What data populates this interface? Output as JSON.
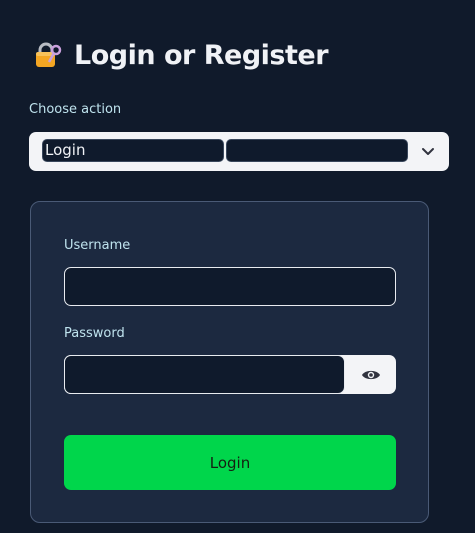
{
  "header": {
    "title": "Login or Register",
    "icon": "lock-with-key-icon"
  },
  "action_select": {
    "label": "Choose action",
    "selected_value": "Login",
    "second_value": "",
    "dropdown_icon": "chevron-down-icon"
  },
  "login_form": {
    "username_label": "Username",
    "username_value": "",
    "password_label": "Password",
    "password_value": "",
    "show_password_icon": "eye-icon",
    "submit_label": "Login"
  },
  "colors": {
    "background": "#101a2b",
    "card": "#1c2940",
    "accent_button": "#00d64b",
    "label_text": "#bfe3ee"
  }
}
